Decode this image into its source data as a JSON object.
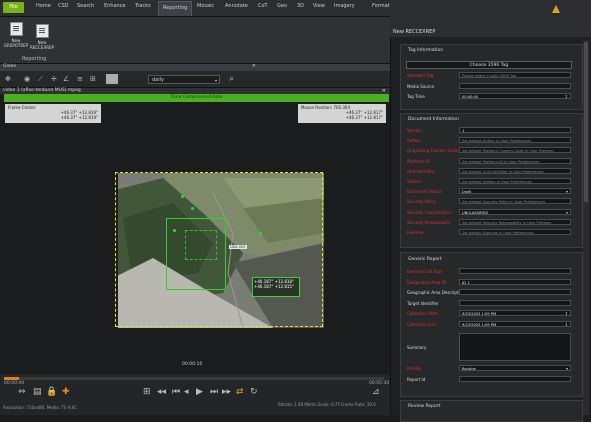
{
  "ribbon": {
    "tabs": [
      "File",
      "Home",
      "CSD",
      "Search",
      "Enhance",
      "Tracks",
      "Reporting",
      "Mosaic",
      "Annotate",
      "CoT",
      "Geo",
      "3D",
      "View",
      "Imagery",
      "Format"
    ],
    "active_tab": "Reporting",
    "buttons": [
      {
        "label_line1": "New",
        "label_line2": "GRSPOTREP"
      },
      {
        "label_line1": "New",
        "label_line2": "RECCEXREP"
      }
    ],
    "group_label": "Reporting"
  },
  "globe_label": "Globe",
  "zoom_value": "daily",
  "video": {
    "tab_label": "video 3 (afloo-tenbura MUS).mpeg",
    "banner": "Time Compressed Rate",
    "frame_center": {
      "title": "Frame Center:",
      "line1": "+46.37° +12.819°",
      "line2": "+46.37° +12.819°"
    },
    "mouse_position": {
      "title": "Mouse Position: 700.304",
      "line1": "+46.37° +12.817°",
      "line2": "+46.37° +12.817°"
    },
    "overlay_tag": "UAS-002",
    "label": {
      "line1": "+46.187° +12.818°",
      "line2": "+46.187° +12.815°"
    },
    "timestamp": "00:00:16",
    "progress": 0.04,
    "time_start": "00:00:00",
    "time_end": "00:05:30",
    "bottom_left": "Resolution: 720x480, Media: TS H.6C",
    "bottom_right": "Bitrate: 1.48 Mbit/s  Scale: 0.75  Frame Rate: 30.0"
  },
  "panel": {
    "title": "New RECCEXREP",
    "tag_info": {
      "title": "Tag Information",
      "choose_button": "Choose 3596 Tag",
      "fields": [
        {
          "label": "Standard Tag",
          "value": "Please select a valid 3596 Tag",
          "required": true,
          "kind": "text",
          "placeholder": true
        },
        {
          "label": "Media Source",
          "value": "",
          "required": false,
          "kind": "text",
          "placeholder": false
        },
        {
          "label": "Tag Time",
          "value": "00:00:00",
          "required": false,
          "kind": "spin",
          "placeholder": false
        }
      ]
    },
    "doc_info": {
      "title": "Document Information",
      "fields": [
        {
          "label": "Version",
          "value": "1",
          "required": true,
          "kind": "text",
          "placeholder": false
        },
        {
          "label": "Author",
          "value": "Set default Author in User Preferences",
          "required": true,
          "kind": "text",
          "placeholder": true
        },
        {
          "label": "Originating Country Code",
          "value": "Set default Platform Country Code in User Preferen",
          "required": true,
          "kind": "text",
          "placeholder": true
        },
        {
          "label": "Platform ID",
          "value": "Set default Platform ID in User Preferences",
          "required": true,
          "kind": "text",
          "placeholder": true
        },
        {
          "label": "Unit Identifier",
          "value": "Set default Unit Identifier in User Preferences",
          "required": true,
          "kind": "text",
          "placeholder": true
        },
        {
          "label": "Station",
          "value": "Set default Station in User Preferences",
          "required": true,
          "kind": "text",
          "placeholder": true
        },
        {
          "label": "Document Status",
          "value": "Draft",
          "required": true,
          "kind": "select",
          "placeholder": false
        },
        {
          "label": "Security Policy",
          "value": "Set default Security Policy in User Preferences",
          "required": true,
          "kind": "text",
          "placeholder": true
        },
        {
          "label": "Security Classification",
          "value": "UNCLASSIFIED",
          "required": true,
          "kind": "select",
          "placeholder": false
        },
        {
          "label": "Security Releasability",
          "value": "Set default Security Releasability in User Preferen",
          "required": true,
          "kind": "text",
          "placeholder": true
        },
        {
          "label": "Exercise",
          "value": "Set default Exercise in User Preferences",
          "required": true,
          "kind": "text",
          "placeholder": true
        }
      ]
    },
    "generic_report": {
      "title": "Generic Report",
      "fields": [
        {
          "label": "Exercise Call Sign",
          "value": "",
          "required": true,
          "kind": "text",
          "placeholder": false
        },
        {
          "label": "Designated Area ID",
          "value": "ID_1",
          "required": true,
          "kind": "text",
          "placeholder": false
        },
        {
          "label": "Geographic Area Description",
          "value": "",
          "required": false,
          "kind": "text",
          "placeholder": false
        },
        {
          "label": "Target Identifier",
          "value": "",
          "required": false,
          "kind": "text",
          "placeholder": false
        },
        {
          "label": "Collection Start",
          "value": "9/23/2025 1:09 PM",
          "required": true,
          "kind": "spin",
          "placeholder": false
        },
        {
          "label": "Collection End",
          "value": "9/23/2025 1:09 PM",
          "required": true,
          "kind": "spin",
          "placeholder": false
        }
      ],
      "summary_label": "Summary",
      "priority": {
        "label": "Priority",
        "value": "Routine"
      },
      "report_id_label": "Report Id"
    },
    "review_title": "Review Report"
  }
}
